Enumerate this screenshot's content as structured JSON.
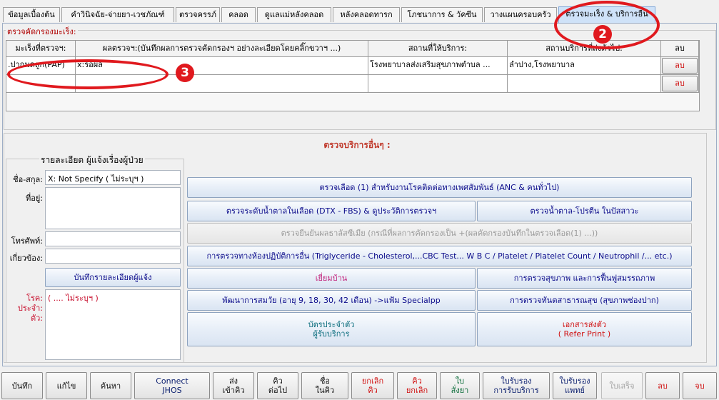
{
  "tabs": [
    {
      "label": "ข้อมูลเบื้องต้น"
    },
    {
      "label": "คำวินิจฉัย-จ่ายยา-เวชภัณฑ์"
    },
    {
      "label": "ตรวจครรภ์"
    },
    {
      "label": "คลอด"
    },
    {
      "label": "ดูแลแม่หลังคลอด"
    },
    {
      "label": "หลังคลอดทารก"
    },
    {
      "label": "โภชนาการ & วัคซีน"
    },
    {
      "label": "วางแผนครอบครัว"
    },
    {
      "label": "ตรวจมะเร็ง & บริการอื่น"
    }
  ],
  "callouts": {
    "two": "2",
    "three": "3"
  },
  "screening": {
    "title": "ตรวจคัดกรองมะเร็ง:",
    "headers": [
      "มะเร็งที่ตรวจฯ:",
      "ผลตรวจฯ:(บันทึกผลการตรวจคัดกรองฯ อย่างละเอียดโดยคลิ๊กขวาฯ ...)",
      "สถานที่ให้บริการ:",
      "สถานบริการที่ส่งตัวไป:",
      "ลบ"
    ],
    "rows": [
      {
        "cancer": ".ปากมดลูก(PAP)",
        "result": "x:รอผล",
        "place": "โรงพยาบาลส่งเสริมสุขภาพตำบล ...",
        "referral": "ลำปาง,โรงพยาบาล",
        "delete": "ลบ"
      },
      {
        "cancer": "",
        "result": "",
        "place": "",
        "referral": "",
        "delete": "ลบ"
      }
    ]
  },
  "other_services": {
    "title": "ตรวจบริการอื่นๆ :",
    "informant": {
      "title": "รายละเอียด ผู้แจ้งเรื่องผู้ป่วย",
      "name_label": "ชื่อ-สกุล:",
      "name_value": "X: Not Specify ( ไม่ระบุฯ )",
      "address_label": "ที่อยู่:",
      "address_value": "",
      "phone_label": "โทรศัพท์:",
      "phone_value": "",
      "relation_label": "เกี่ยวข้อง:",
      "relation_value": "",
      "save_button": "บันทึกรายละเอียดผู้แจ้ง",
      "disease_label_1": "โรค:",
      "disease_label_2": "ประจำ:",
      "disease_label_3": "ตัว:",
      "disease_value": "( .... ไม่ระบุฯ )"
    },
    "buttons": {
      "blood_std": "ตรวจเลือด (1) สำหรับงานโรคติดต่อทางเพศสัมพันธ์ (ANC & คนทั่วไป)",
      "blood_sugar": "ตรวจระดับน้ำตาลในเลือด (DTX - FBS) & ดูประวัติการตรวจฯ",
      "urine": "ตรวจน้ำตาล-โปรตีน ในปัสสาวะ",
      "thalassemia": "ตรวจยืนยันผลธาลัสซีเมีย (กรณีที่ผลการคัดกรองเป็น +(ผลคัดกรองบันทึกในตรวจเลือด(1) ...))",
      "lab": "การตรวจทางห้องปฏิบัติการอื่น (Triglyceride - Cholesterol,...CBC Test... W B C / Platelet / Platelet Count / Neutrophil /... etc.)",
      "home_visit": "เยี่ยมบ้าน",
      "health_check": "การตรวจสุขภาพ และการฟื้นฟูสมรรถภาพ",
      "development": "พัฒนาการสมวัย (อายุ 9, 18, 30, 42 เดือน) ->แฟ้ม Specialpp",
      "dental": "การตรวจทันตสาธารณสุข (สุขภาพช่องปาก)",
      "card_line1": "บัตรประจำตัว",
      "card_line2": "ผู้รับบริการ",
      "refer_line1": "เอกสารส่งตัว",
      "refer_line2": "( Refer Print )"
    }
  },
  "toolbar": [
    {
      "line1": "บันทึก",
      "line2": ""
    },
    {
      "line1": "แก้ไข",
      "line2": ""
    },
    {
      "line1": "ค้นหา",
      "line2": ""
    },
    {
      "line1": "Connect",
      "line2": "JHOS"
    },
    {
      "line1": "ส่ง",
      "line2": "เข้าคิว"
    },
    {
      "line1": "คิว",
      "line2": "ต่อไป"
    },
    {
      "line1": "ชื่อ",
      "line2": "ในคิว"
    },
    {
      "line1": "ยกเลิก",
      "line2": "คิว"
    },
    {
      "line1": "คิว",
      "line2": "ยกเลิก"
    },
    {
      "line1": "ใบ",
      "line2": "สั่งยา"
    },
    {
      "line1": "ใบรับรอง",
      "line2": "การรับบริการ"
    },
    {
      "line1": "ใบรับรอง",
      "line2": "แพทย์"
    },
    {
      "line1": "ใบเสร็จ",
      "line2": ""
    },
    {
      "line1": "ลบ",
      "line2": ""
    },
    {
      "line1": "จบ",
      "line2": ""
    }
  ]
}
